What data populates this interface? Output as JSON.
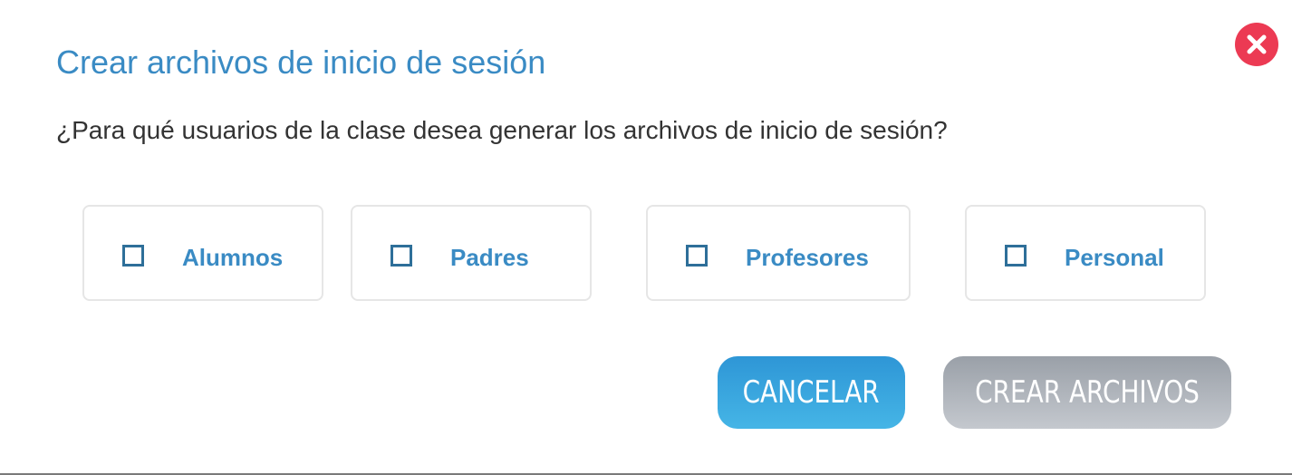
{
  "dialog": {
    "title": "Crear archivos de inicio de sesión",
    "question": "¿Para qué usuarios de la clase desea generar los archivos de inicio de sesión?",
    "close_icon": "close-x-icon",
    "close_color": "#ec3a53"
  },
  "options": [
    {
      "label": "Alumnos",
      "checked": false
    },
    {
      "label": "Padres",
      "checked": false
    },
    {
      "label": "Profesores",
      "checked": false
    },
    {
      "label": "Personal",
      "checked": false
    }
  ],
  "buttons": {
    "cancel_label": "CANCELAR",
    "create_label": "CREAR ARCHIVOS",
    "cancel_color": "#3aa6de",
    "create_color": "#b0b5bc",
    "create_enabled": false
  },
  "colors": {
    "title": "#3a8bc4",
    "text": "#333333",
    "checkbox_border": "#2e6f99",
    "option_border": "#e6e6e6"
  }
}
